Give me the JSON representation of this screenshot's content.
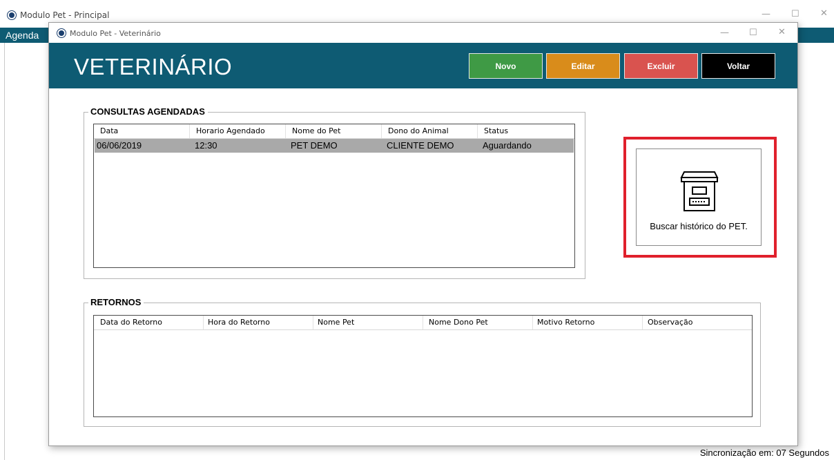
{
  "main_window": {
    "title": "Modulo Pet - Principal",
    "menu_label": "Agenda",
    "status": "Sincronização em: 07 Segundos"
  },
  "child_window": {
    "title": "Modulo Pet - Veterinário",
    "page_title": "VETERINÁRIO",
    "buttons": {
      "new": "Novo",
      "edit": "Editar",
      "delete": "Excluir",
      "back": "Voltar"
    },
    "colors": {
      "header": "#0e5b73",
      "new": "#3f9a45",
      "edit": "#d98c1b",
      "delete": "#d9534f",
      "back": "#000000",
      "highlight": "#e0202c"
    }
  },
  "consultas": {
    "title": "CONSULTAS AGENDADAS",
    "columns": [
      "Data",
      "Horario Agendado",
      "Nome do Pet",
      "Dono do Animal",
      "Status"
    ],
    "rows": [
      [
        "06/06/2019",
        "12:30",
        "PET DEMO",
        "CLIENTE DEMO",
        "Aguardando"
      ]
    ]
  },
  "retornos": {
    "title": "RETORNOS",
    "columns": [
      "Data do Retorno",
      "Hora do Retorno",
      "Nome Pet",
      "Nome Dono Pet",
      "Motivo Retorno",
      "Observação"
    ],
    "rows": []
  },
  "history_button": {
    "label": "Buscar histórico do PET.",
    "icon": "archive-box-icon"
  }
}
